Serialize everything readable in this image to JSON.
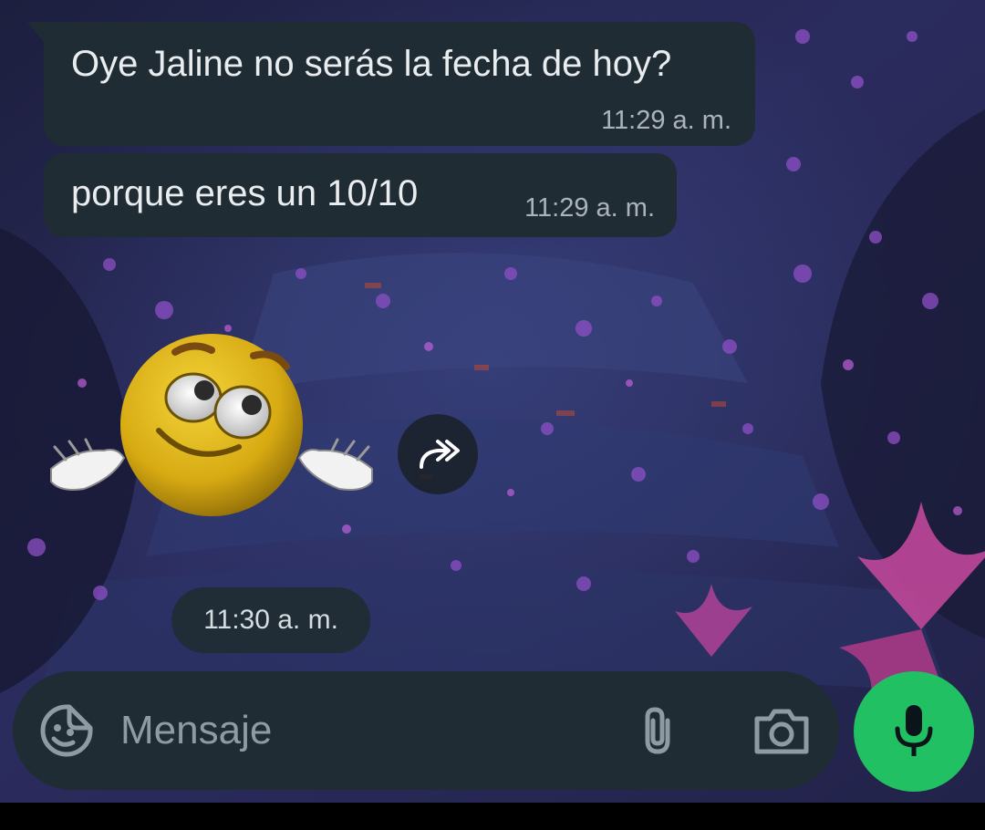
{
  "messages": [
    {
      "text": "Oye Jaline no serás la fecha de hoy?",
      "time": "11:29 a. m."
    },
    {
      "text": "porque eres un 10/10",
      "time": "11:29 a. m."
    }
  ],
  "sticker": {
    "icon": "shrugging-emoji-sticker",
    "time": "11:30 a. m."
  },
  "composer": {
    "placeholder": "Mensaje",
    "emoji_icon": "sticker-smiley-icon",
    "attach_icon": "paperclip-icon",
    "camera_icon": "camera-icon",
    "mic_icon": "microphone-icon"
  },
  "colors": {
    "bubble": "#202c33",
    "accent_green": "#21c063",
    "timestamp": "#aab4ba",
    "input_bar": "#1f2c33"
  }
}
